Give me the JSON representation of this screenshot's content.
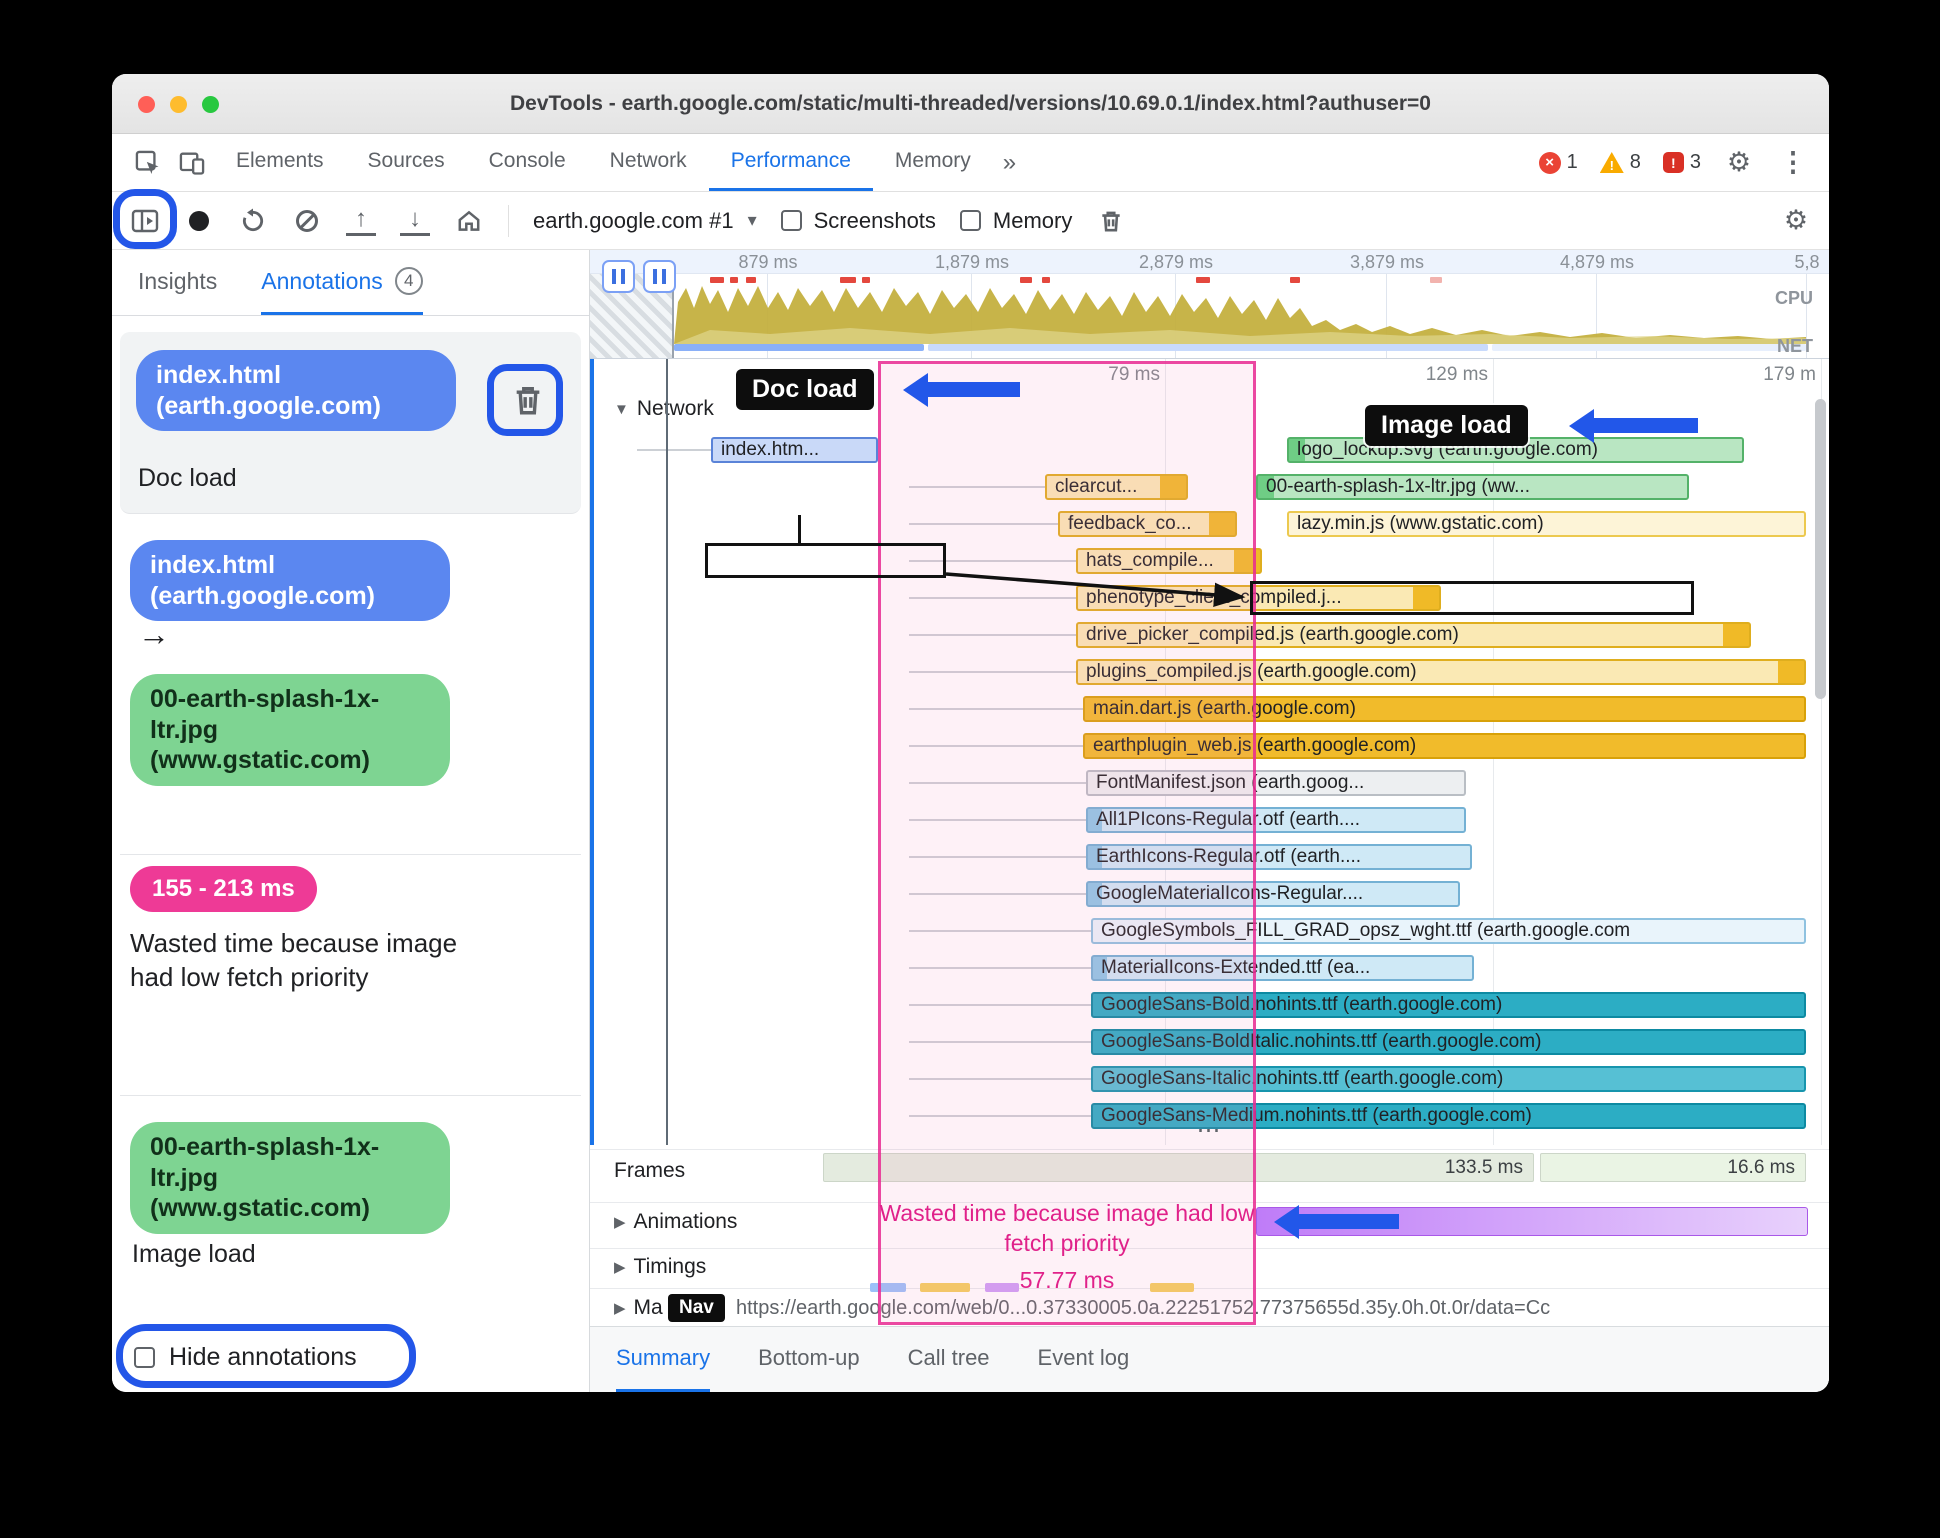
{
  "window": {
    "title": "DevTools - earth.google.com/static/multi-threaded/versions/10.69.0.1/index.html?authuser=0"
  },
  "icons": {
    "more_tabs": "»",
    "kebab": "⋮",
    "gear": "⚙",
    "error_x": "×",
    "warning_mark": "!",
    "issue_mark": "!",
    "dropdown_caret": "▾",
    "collapse_open": "▼",
    "collapse_closed": "▶",
    "upload_arrow": "↑",
    "download_arrow": "↓"
  },
  "tabbar": {
    "tabs": [
      {
        "label": "Elements",
        "active": "false"
      },
      {
        "label": "Sources",
        "active": "false"
      },
      {
        "label": "Console",
        "active": "false"
      },
      {
        "label": "Network",
        "active": "false"
      },
      {
        "label": "Performance",
        "active": "true"
      },
      {
        "label": "Memory",
        "active": "false"
      }
    ],
    "error_count": "1",
    "warning_count": "8",
    "issue_count": "3"
  },
  "toolbar": {
    "target": "earth.google.com #1",
    "screenshots_label": "Screenshots",
    "memory_label": "Memory"
  },
  "sidebar": {
    "tab_insights": "Insights",
    "tab_annotations": "Annotations",
    "annotations_count": "4",
    "entry1": {
      "pill": "index.html (earth.google.com)",
      "label": "Doc load"
    },
    "entry2": {
      "from": "index.html (earth.google.com)",
      "arrow": "→",
      "to": "00-earth-splash-1x-ltr.jpg (www.gstatic.com)"
    },
    "entry3": {
      "range": "155 - 213 ms",
      "text": "Wasted time because image had low fetch priority"
    },
    "entry4": {
      "pill": "00-earth-splash-1x-ltr.jpg (www.gstatic.com)",
      "label": "Image load"
    },
    "hide_label": "Hide annotations"
  },
  "overview": {
    "ticks": [
      {
        "label": "879 ms",
        "style": "left:177px"
      },
      {
        "label": "1,879 ms",
        "style": "left:381px"
      },
      {
        "label": "2,879 ms",
        "style": "left:585px"
      },
      {
        "label": "3,879 ms",
        "style": "left:796px"
      },
      {
        "label": "4,879 ms",
        "style": "left:1006px"
      },
      {
        "label": "5,8",
        "style": "left:1216px"
      }
    ],
    "cpu_label": "CPU",
    "net_label": "NET"
  },
  "waterfall": {
    "ruler": [
      {
        "label": "79 ms",
        "style": "left:575px"
      },
      {
        "label": "129 ms",
        "style": "left:903px"
      },
      {
        "label": "179 m",
        "style": "left:1231px"
      }
    ],
    "track_label": "Network",
    "more_indicator": "⋯",
    "doc_chip": "Doc load",
    "image_chip": "Image load",
    "wasted_line": "Wasted time because image had low fetch priority",
    "wasted_ms": "57.77 ms",
    "requests": [
      {
        "label": "index.htm...",
        "style": "left:121px;top:78px;width:167px",
        "color": "doc"
      },
      {
        "label": "logo_lockup.svg (earth.google.com)",
        "style": "left:697px;top:78px;width:457px",
        "color": "img"
      },
      {
        "label": "clearcut...",
        "style": "left:455px;top:115px;width:143px",
        "color": "js"
      },
      {
        "label": "00-earth-splash-1x-ltr.jpg (ww...",
        "style": "left:666px;top:115px;width:433px",
        "color": "img"
      },
      {
        "label": "feedback_co...",
        "style": "left:468px;top:152px;width:179px",
        "color": "js"
      },
      {
        "label": "lazy.min.js (www.gstatic.com)",
        "style": "left:697px;top:152px;width:519px",
        "color": "js-pale"
      },
      {
        "label": "hats_compile...",
        "style": "left:486px;top:189px;width:186px",
        "color": "js"
      },
      {
        "label": "phenotype_client_compiled.j...",
        "style": "left:486px;top:226px;width:365px",
        "color": "js"
      },
      {
        "label": "drive_picker_compiled.js (earth.google.com)",
        "style": "left:486px;top:263px;width:675px",
        "color": "js"
      },
      {
        "label": "plugins_compiled.js (earth.google.com)",
        "style": "left:486px;top:300px;width:730px",
        "color": "js"
      },
      {
        "label": "main.dart.js (earth.google.com)",
        "style": "left:493px;top:337px;width:723px",
        "color": "js-solid"
      },
      {
        "label": "earthplugin_web.js (earth.google.com)",
        "style": "left:493px;top:374px;width:723px",
        "color": "js-solid"
      },
      {
        "label": "FontManifest.json (earth.goog...",
        "style": "left:496px;top:411px;width:380px",
        "color": "gray"
      },
      {
        "label": "All1PIcons-Regular.otf (earth....",
        "style": "left:496px;top:448px;width:380px",
        "color": "font"
      },
      {
        "label": "EarthIcons-Regular.otf (earth....",
        "style": "left:496px;top:485px;width:386px",
        "color": "font"
      },
      {
        "label": "GoogleMaterialIcons-Regular....",
        "style": "left:496px;top:522px;width:374px",
        "color": "font"
      },
      {
        "label": "GoogleSymbols_FILL_GRAD_opsz_wght.ttf (earth.google.com",
        "style": "left:501px;top:559px;width:715px",
        "color": "font-pale"
      },
      {
        "label": "MaterialIcons-Extended.ttf (ea...",
        "style": "left:501px;top:596px;width:383px",
        "color": "font"
      },
      {
        "label": "GoogleSans-Bold.nohints.ttf (earth.google.com)",
        "style": "left:501px;top:633px;width:715px",
        "color": "teal"
      },
      {
        "label": "GoogleSans-BoldItalic.nohints.ttf (earth.google.com)",
        "style": "left:501px;top:670px;width:715px",
        "color": "teal"
      },
      {
        "label": "GoogleSans-Italic.nohints.ttf (earth.google.com)",
        "style": "left:501px;top:707px;width:715px",
        "color": "teal-light"
      },
      {
        "label": "GoogleSans-Medium.nohints.ttf (earth.google.com)",
        "style": "left:501px;top:744px;width:715px",
        "color": "teal"
      }
    ],
    "whiskers": [
      {
        "style": "left:47px;top:90px;width:74px"
      },
      {
        "style": "left:319px;top:127px;width:136px"
      },
      {
        "style": "left:319px;top:164px;width:149px"
      },
      {
        "style": "left:319px;top:201px;width:167px"
      },
      {
        "style": "left:319px;top:238px;width:167px"
      },
      {
        "style": "left:319px;top:275px;width:167px"
      },
      {
        "style": "left:319px;top:312px;width:167px"
      },
      {
        "style": "left:319px;top:349px;width:174px"
      },
      {
        "style": "left:319px;top:386px;width:174px"
      },
      {
        "style": "left:319px;top:423px;width:177px"
      },
      {
        "style": "left:319px;top:460px;width:177px"
      },
      {
        "style": "left:319px;top:497px;width:177px"
      },
      {
        "style": "left:319px;top:534px;width:177px"
      },
      {
        "style": "left:319px;top:571px;width:182px"
      },
      {
        "style": "left:319px;top:608px;width:182px"
      },
      {
        "style": "left:319px;top:645px;width:182px"
      },
      {
        "style": "left:319px;top:682px;width:182px"
      },
      {
        "style": "left:319px;top:719px;width:182px"
      },
      {
        "style": "left:319px;top:756px;width:182px"
      }
    ]
  },
  "tracks": {
    "frames_label": "Frames",
    "frames_bars": [
      {
        "label": "133.5 ms",
        "style": "left:233px;width:711px",
        "color": "frame-a"
      },
      {
        "label": "16.6 ms",
        "style": "left:950px;width:266px",
        "color": "frame-b"
      }
    ],
    "animations_label": "Animations",
    "timings_label": "Timings",
    "main_label": "Ma",
    "nav_chip": "Nav",
    "nav_url": "https://earth.google.com/web/0...0.37330005.0a.22251752.77375655d.35y.0h.0t.0r/data=Cc"
  },
  "drawer": {
    "tabs": [
      {
        "label": "Summary",
        "active": "true"
      },
      {
        "label": "Bottom-up",
        "active": "false"
      },
      {
        "label": "Call tree",
        "active": "false"
      },
      {
        "label": "Event log",
        "active": "false"
      }
    ]
  }
}
